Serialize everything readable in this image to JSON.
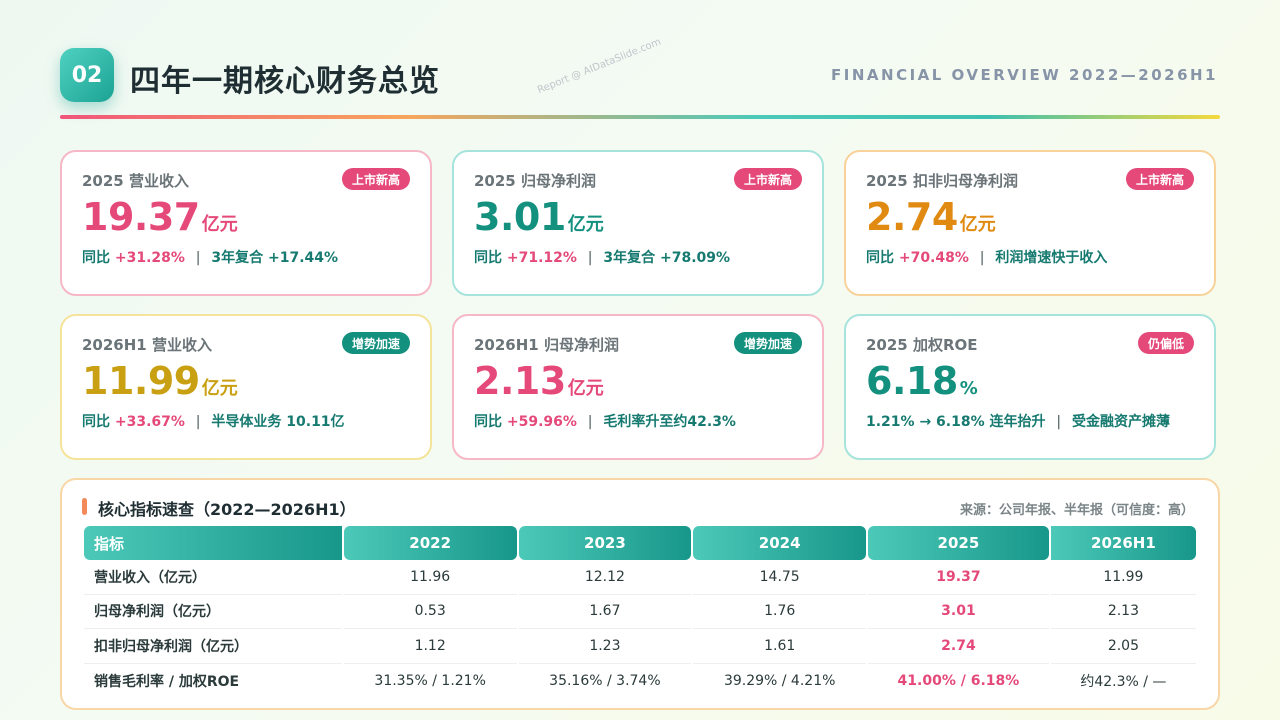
{
  "header": {
    "badge": "02",
    "title": "四年一期核心财务总览",
    "subtitle": "FINANCIAL OVERVIEW 2022—2026H1",
    "watermark": "Report @ AIDataSlide.com"
  },
  "cards": [
    {
      "label": "2025 营业收入",
      "tag": "上市新高",
      "value": "19.37",
      "unit": "亿元",
      "line1_prefix": "同比",
      "line1_value": "+31.28%",
      "line2": "3年复合 +17.44%"
    },
    {
      "label": "2025 归母净利润",
      "tag": "上市新高",
      "value": "3.01",
      "unit": "亿元",
      "line1_prefix": "同比",
      "line1_value": "+71.12%",
      "line2": "3年复合 +78.09%"
    },
    {
      "label": "2025 扣非归母净利润",
      "tag": "上市新高",
      "value": "2.74",
      "unit": "亿元",
      "line1_prefix": "同比",
      "line1_value": "+70.48%",
      "line2": "利润增速快于收入"
    },
    {
      "label": "2026H1 营业收入",
      "tag": "增势加速",
      "value": "11.99",
      "unit": "亿元",
      "line1_prefix": "同比",
      "line1_value": "+33.67%",
      "line2": "半导体业务 10.11亿"
    },
    {
      "label": "2026H1 归母净利润",
      "tag": "增势加速",
      "value": "2.13",
      "unit": "亿元",
      "line1_prefix": "同比",
      "line1_value": "+59.96%",
      "line2": "毛利率升至约42.3%"
    },
    {
      "label": "2025 加权ROE",
      "tag": "仍偏低",
      "value": "6.18",
      "unit": "%",
      "line1_prefix": "1.21% → 6.18% 连年抬升",
      "line1_value": "",
      "line2": "受金融资产摊薄"
    }
  ],
  "table": {
    "title": "核心指标速查（2022—2026H1）",
    "source": "来源：公司年报、半年报（可信度：高）",
    "headers": [
      "指标",
      "2022",
      "2023",
      "2024",
      "2025",
      "2026H1"
    ],
    "rows": [
      [
        "营业收入（亿元）",
        "11.96",
        "12.12",
        "14.75",
        "19.37",
        "11.99"
      ],
      [
        "归母净利润（亿元）",
        "0.53",
        "1.67",
        "1.76",
        "3.01",
        "2.13"
      ],
      [
        "扣非归母净利润（亿元）",
        "1.12",
        "1.23",
        "1.61",
        "2.74",
        "2.05"
      ],
      [
        "销售毛利率 / 加权ROE",
        "31.35% / 1.21%",
        "35.16% / 3.74%",
        "39.29% / 4.21%",
        "41.00% / 6.18%",
        "约42.3% / —"
      ]
    ]
  }
}
